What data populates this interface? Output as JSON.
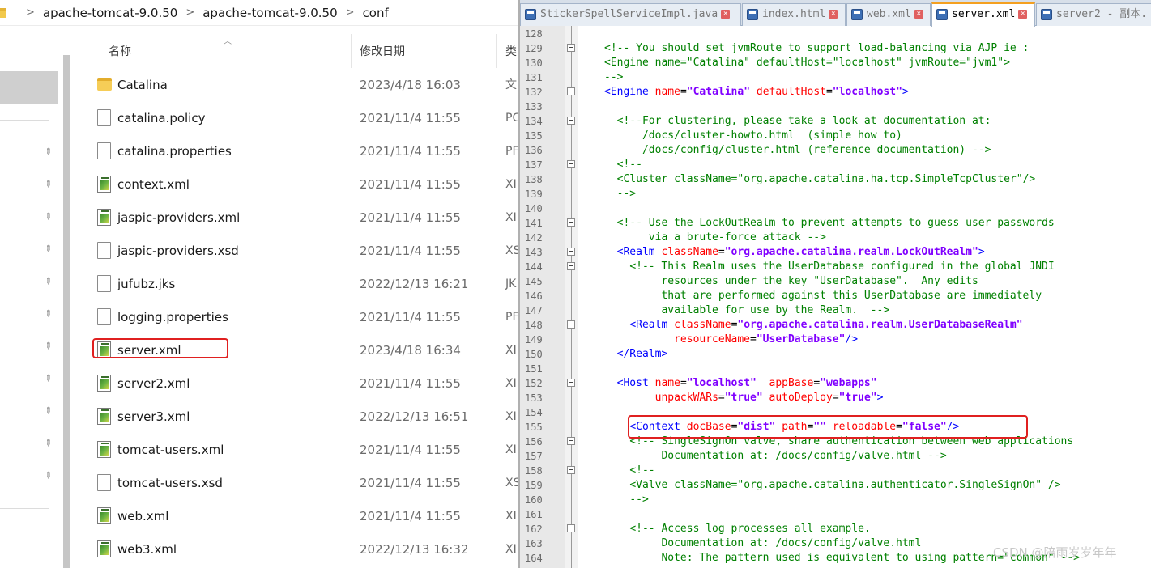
{
  "breadcrumb": {
    "items": [
      "apache-tomcat-9.0.50",
      "apache-tomcat-9.0.50",
      "conf"
    ],
    "separator": ">"
  },
  "columns": {
    "name": "名称",
    "date": "修改日期",
    "type": "类"
  },
  "files": [
    {
      "name": "Catalina",
      "date": "2023/4/18 16:03",
      "type": "文",
      "icon": "folder-icon"
    },
    {
      "name": "catalina.policy",
      "date": "2021/11/4 11:55",
      "type": "PC",
      "icon": "document-icon"
    },
    {
      "name": "catalina.properties",
      "date": "2021/11/4 11:55",
      "type": "PF",
      "icon": "document-icon"
    },
    {
      "name": "context.xml",
      "date": "2021/11/4 11:55",
      "type": "XI",
      "icon": "xml-file-icon"
    },
    {
      "name": "jaspic-providers.xml",
      "date": "2021/11/4 11:55",
      "type": "XI",
      "icon": "xml-file-icon"
    },
    {
      "name": "jaspic-providers.xsd",
      "date": "2021/11/4 11:55",
      "type": "XS",
      "icon": "document-icon"
    },
    {
      "name": "jufubz.jks",
      "date": "2022/12/13 16:21",
      "type": "JK",
      "icon": "document-icon"
    },
    {
      "name": "logging.properties",
      "date": "2021/11/4 11:55",
      "type": "PF",
      "icon": "document-icon"
    },
    {
      "name": "server.xml",
      "date": "2023/4/18 16:34",
      "type": "XI",
      "icon": "xml-file-icon"
    },
    {
      "name": "server2.xml",
      "date": "2021/11/4 11:55",
      "type": "XI",
      "icon": "xml-file-icon"
    },
    {
      "name": "server3.xml",
      "date": "2022/12/13 16:51",
      "type": "XI",
      "icon": "xml-file-icon"
    },
    {
      "name": "tomcat-users.xml",
      "date": "2021/11/4 11:55",
      "type": "XI",
      "icon": "xml-file-icon"
    },
    {
      "name": "tomcat-users.xsd",
      "date": "2021/11/4 11:55",
      "type": "XS",
      "icon": "document-icon"
    },
    {
      "name": "web.xml",
      "date": "2021/11/4 11:55",
      "type": "XI",
      "icon": "xml-file-icon"
    },
    {
      "name": "web3.xml",
      "date": "2022/12/13 16:32",
      "type": "XI",
      "icon": "xml-file-icon"
    }
  ],
  "editor": {
    "tabs": [
      {
        "label": "StickerSpellServiceImpl.java",
        "active": false
      },
      {
        "label": "index.html",
        "active": false
      },
      {
        "label": "web.xml",
        "active": false
      },
      {
        "label": "server.xml",
        "active": true
      },
      {
        "label": "server2 - 副本.",
        "active": false
      }
    ],
    "lines": [
      {
        "n": "128",
        "t": []
      },
      {
        "n": "129",
        "t": [
          [
            "c",
            "<!-- You should set jvmRoute to support load-balancing via AJP ie :"
          ]
        ]
      },
      {
        "n": "130",
        "t": [
          [
            "c",
            "<Engine name=\"Catalina\" defaultHost=\"localhost\" jvmRoute=\"jvm1\">"
          ]
        ]
      },
      {
        "n": "131",
        "t": [
          [
            "c",
            "-->"
          ]
        ]
      },
      {
        "n": "132",
        "t": [
          [
            "g",
            "<Engine "
          ],
          [
            "a",
            "name"
          ],
          [
            "x",
            "="
          ],
          [
            "v",
            "\"Catalina\""
          ],
          [
            "x",
            " "
          ],
          [
            "a",
            "defaultHost"
          ],
          [
            "x",
            "="
          ],
          [
            "v",
            "\"localhost\""
          ],
          [
            "g",
            ">"
          ]
        ]
      },
      {
        "n": "133",
        "t": []
      },
      {
        "n": "134",
        "t": [
          [
            "x",
            "  "
          ],
          [
            "c",
            "<!--For clustering, please take a look at documentation at:"
          ]
        ]
      },
      {
        "n": "135",
        "t": [
          [
            "c",
            "      /docs/cluster-howto.html  (simple how to)"
          ]
        ]
      },
      {
        "n": "136",
        "t": [
          [
            "c",
            "      /docs/config/cluster.html (reference documentation) -->"
          ]
        ]
      },
      {
        "n": "137",
        "t": [
          [
            "x",
            "  "
          ],
          [
            "c",
            "<!--"
          ]
        ]
      },
      {
        "n": "138",
        "t": [
          [
            "x",
            "  "
          ],
          [
            "c",
            "<Cluster className=\"org.apache.catalina.ha.tcp.SimpleTcpCluster\"/>"
          ]
        ]
      },
      {
        "n": "139",
        "t": [
          [
            "x",
            "  "
          ],
          [
            "c",
            "-->"
          ]
        ]
      },
      {
        "n": "140",
        "t": []
      },
      {
        "n": "141",
        "t": [
          [
            "x",
            "  "
          ],
          [
            "c",
            "<!-- Use the LockOutRealm to prevent attempts to guess user passwords"
          ]
        ]
      },
      {
        "n": "142",
        "t": [
          [
            "c",
            "       via a brute-force attack -->"
          ]
        ]
      },
      {
        "n": "143",
        "t": [
          [
            "x",
            "  "
          ],
          [
            "g",
            "<Realm "
          ],
          [
            "a",
            "className"
          ],
          [
            "x",
            "="
          ],
          [
            "v",
            "\"org.apache.catalina.realm.LockOutRealm\""
          ],
          [
            "g",
            ">"
          ]
        ]
      },
      {
        "n": "144",
        "t": [
          [
            "x",
            "    "
          ],
          [
            "c",
            "<!-- This Realm uses the UserDatabase configured in the global JNDI"
          ]
        ]
      },
      {
        "n": "145",
        "t": [
          [
            "c",
            "         resources under the key \"UserDatabase\".  Any edits"
          ]
        ]
      },
      {
        "n": "146",
        "t": [
          [
            "c",
            "         that are performed against this UserDatabase are immediately"
          ]
        ]
      },
      {
        "n": "147",
        "t": [
          [
            "c",
            "         available for use by the Realm.  -->"
          ]
        ]
      },
      {
        "n": "148",
        "t": [
          [
            "x",
            "    "
          ],
          [
            "g",
            "<Realm "
          ],
          [
            "a",
            "className"
          ],
          [
            "x",
            "="
          ],
          [
            "v",
            "\"org.apache.catalina.realm.UserDatabaseRealm\""
          ]
        ]
      },
      {
        "n": "149",
        "t": [
          [
            "x",
            "           "
          ],
          [
            "a",
            "resourceName"
          ],
          [
            "x",
            "="
          ],
          [
            "v",
            "\"UserDatabase\""
          ],
          [
            "g",
            "/>"
          ]
        ]
      },
      {
        "n": "150",
        "t": [
          [
            "x",
            "  "
          ],
          [
            "g",
            "</Realm>"
          ]
        ]
      },
      {
        "n": "151",
        "t": []
      },
      {
        "n": "152",
        "t": [
          [
            "x",
            "  "
          ],
          [
            "g",
            "<Host "
          ],
          [
            "a",
            "name"
          ],
          [
            "x",
            "="
          ],
          [
            "v",
            "\"localhost\""
          ],
          [
            "x",
            "  "
          ],
          [
            "a",
            "appBase"
          ],
          [
            "x",
            "="
          ],
          [
            "v",
            "\"webapps\""
          ]
        ]
      },
      {
        "n": "153",
        "t": [
          [
            "x",
            "        "
          ],
          [
            "a",
            "unpackWARs"
          ],
          [
            "x",
            "="
          ],
          [
            "v",
            "\"true\""
          ],
          [
            "x",
            " "
          ],
          [
            "a",
            "autoDeploy"
          ],
          [
            "x",
            "="
          ],
          [
            "v",
            "\"true\""
          ],
          [
            "g",
            ">"
          ]
        ]
      },
      {
        "n": "154",
        "t": []
      },
      {
        "n": "155",
        "t": [
          [
            "x",
            "    "
          ],
          [
            "g",
            "<Context "
          ],
          [
            "a",
            "docBase"
          ],
          [
            "x",
            "="
          ],
          [
            "v",
            "\"dist\""
          ],
          [
            "x",
            " "
          ],
          [
            "a",
            "path"
          ],
          [
            "x",
            "="
          ],
          [
            "v",
            "\"\""
          ],
          [
            "x",
            " "
          ],
          [
            "a",
            "reloadable"
          ],
          [
            "x",
            "="
          ],
          [
            "v",
            "\"false\""
          ],
          [
            "g",
            "/>"
          ]
        ]
      },
      {
        "n": "156",
        "t": [
          [
            "x",
            "    "
          ],
          [
            "c",
            "<!-- SingleSignOn valve, share authentication between web applications"
          ]
        ]
      },
      {
        "n": "157",
        "t": [
          [
            "c",
            "         Documentation at: /docs/config/valve.html -->"
          ]
        ]
      },
      {
        "n": "158",
        "t": [
          [
            "x",
            "    "
          ],
          [
            "c",
            "<!--"
          ]
        ]
      },
      {
        "n": "159",
        "t": [
          [
            "x",
            "    "
          ],
          [
            "c",
            "<Valve className=\"org.apache.catalina.authenticator.SingleSignOn\" />"
          ]
        ]
      },
      {
        "n": "160",
        "t": [
          [
            "x",
            "    "
          ],
          [
            "c",
            "-->"
          ]
        ]
      },
      {
        "n": "161",
        "t": []
      },
      {
        "n": "162",
        "t": [
          [
            "x",
            "    "
          ],
          [
            "c",
            "<!-- Access log processes all example."
          ]
        ]
      },
      {
        "n": "163",
        "t": [
          [
            "c",
            "         Documentation at: /docs/config/valve.html"
          ]
        ]
      },
      {
        "n": "164",
        "t": [
          [
            "c",
            "         Note: The pattern used is equivalent to using pattern=\"common\" -->"
          ]
        ]
      }
    ]
  },
  "watermark": "CSDN @陪雨岁岁年年"
}
